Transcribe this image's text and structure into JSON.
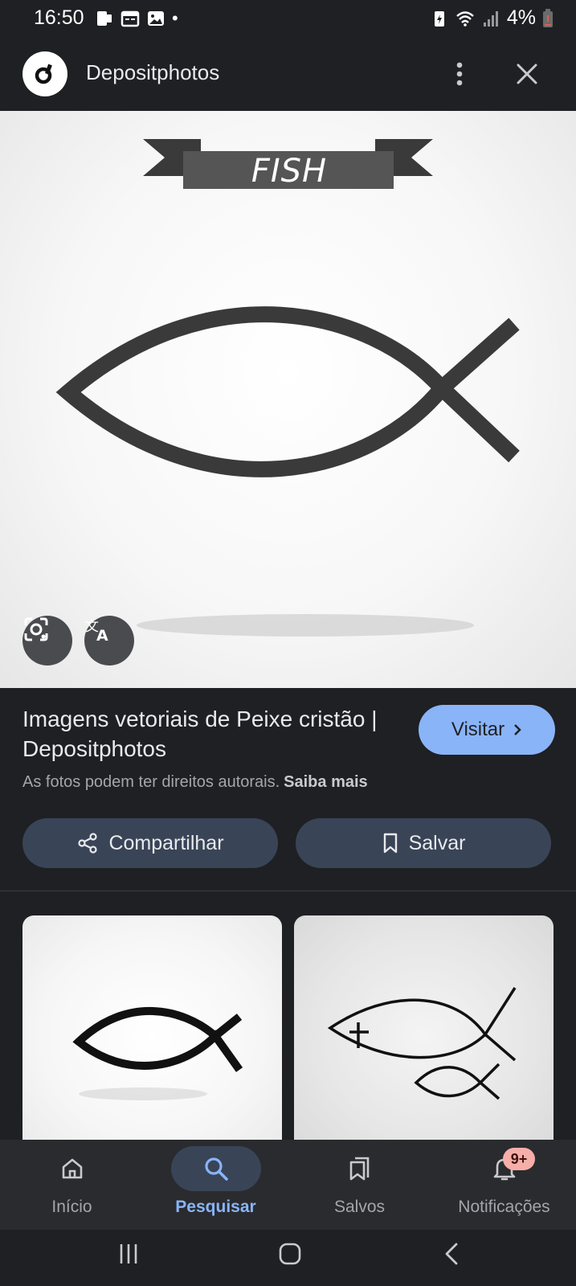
{
  "status_bar": {
    "time": "16:50",
    "dot": "•",
    "battery": "4%",
    "icons": [
      "notification-icon",
      "calendar-icon",
      "gallery-icon",
      "battery-saver-icon",
      "wifi-icon",
      "signal-icon",
      "battery-icon"
    ]
  },
  "app_bar": {
    "site_name": "Depositphotos",
    "logo_icon": "depositphotos-logo-icon",
    "more_icon": "more-vert-icon",
    "close_icon": "close-icon"
  },
  "hero": {
    "banner_text": "FISH",
    "lens_icon": "google-lens-icon",
    "translate_icon": "translate-icon"
  },
  "info": {
    "title": "Imagens vetoriais de Peixe cristão | Depositphotos",
    "visit_label": "Visitar",
    "copyright_text": "As fotos podem ter direitos autorais.",
    "learn_more": "Saiba mais",
    "share_label": "Compartilhar",
    "save_label": "Salvar"
  },
  "bottom_nav": {
    "items": [
      {
        "label": "Início",
        "icon": "home-icon"
      },
      {
        "label": "Pesquisar",
        "icon": "search-icon"
      },
      {
        "label": "Salvos",
        "icon": "saved-icon"
      },
      {
        "label": "Notificações",
        "icon": "bell-icon"
      }
    ],
    "badge": "9+",
    "active_index": 1
  },
  "colors": {
    "background": "#1f2023",
    "accent": "#8ab4f8",
    "pill": "#394457",
    "badge": "#f6aea9"
  }
}
